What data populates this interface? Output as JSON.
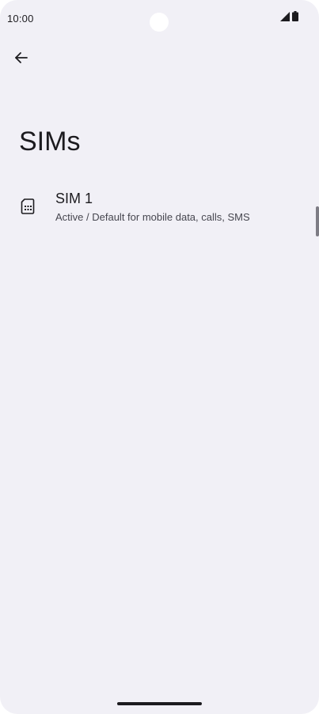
{
  "status_bar": {
    "time": "10:00",
    "icons": [
      "signal-icon",
      "battery-icon"
    ]
  },
  "header": {
    "back_icon": "back-arrow-icon",
    "title": "SIMs"
  },
  "sim_list": [
    {
      "icon": "sim-card-icon",
      "title": "SIM 1",
      "summary": "Active / Default for mobile data, calls, SMS"
    }
  ],
  "colors": {
    "background": "#f1f0f6",
    "text_primary": "#1c1b1f",
    "text_secondary": "#46464f"
  }
}
